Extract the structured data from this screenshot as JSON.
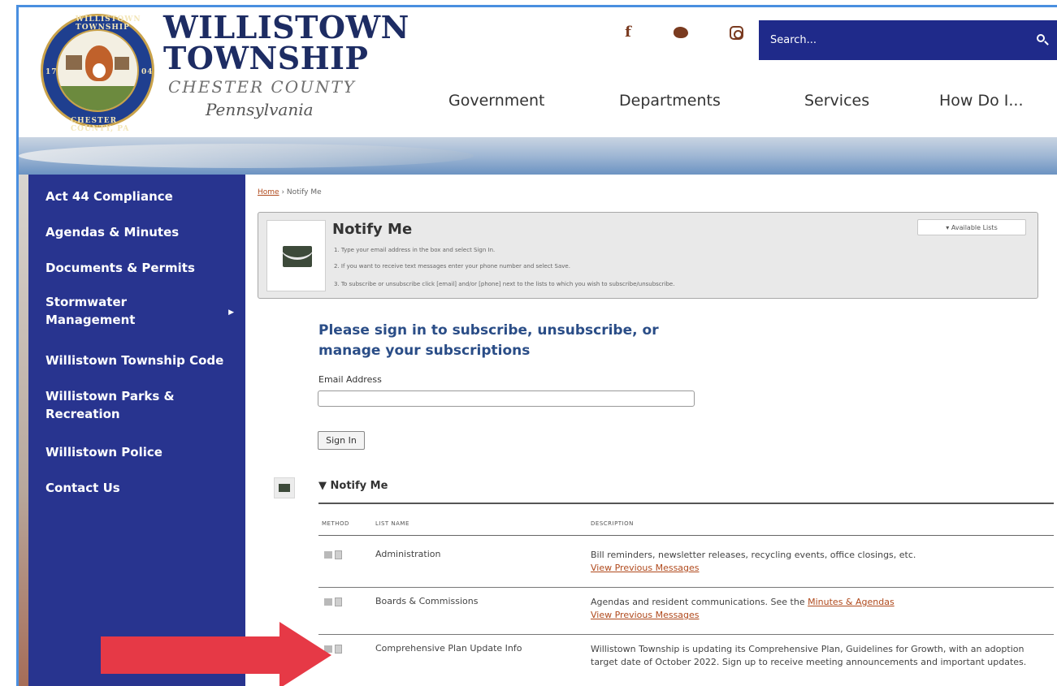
{
  "logo": {
    "title_line1": "WILLISTOWN",
    "title_line2": "TOWNSHIP",
    "county": "CHESTER COUNTY",
    "state": "Pennsylvania",
    "seal_top": "WILLISTOWN TOWNSHIP",
    "seal_bottom": "CHESTER COUNTY, PA",
    "seal_left": "17",
    "seal_right": "04"
  },
  "social": {
    "facebook": "f",
    "twitter_icon": "twitter-icon",
    "instagram_icon": "instagram-icon"
  },
  "search": {
    "placeholder": "Search..."
  },
  "nav": {
    "government": "Government",
    "departments": "Departments",
    "services": "Services",
    "how_do_i": "How Do I..."
  },
  "sidebar": {
    "items": [
      {
        "label": "Act 44 Compliance"
      },
      {
        "label": "Agendas & Minutes"
      },
      {
        "label": "Documents & Permits"
      },
      {
        "label": "Stormwater Management"
      },
      {
        "label": "Willistown Township Code"
      },
      {
        "label": "Willistown Parks & Recreation"
      },
      {
        "label": "Willistown Police"
      },
      {
        "label": "Contact Us"
      }
    ],
    "arrow": "▶"
  },
  "breadcrumb": {
    "home": "Home",
    "sep": " › ",
    "current": "Notify Me"
  },
  "notify_box": {
    "title": "Notify Me",
    "step1": "1. Type your email address in the box and select Sign In.",
    "step2": "2. If you want to receive text messages enter your phone number and select Save.",
    "step3": "3. To subscribe or unsubscribe click [email] and/or [phone] next to the lists to which you wish to subscribe/unsubscribe.",
    "available_lists": "▾  Available Lists"
  },
  "signin": {
    "heading": "Please sign in to subscribe, unsubscribe, or manage your subscriptions",
    "email_label": "Email Address",
    "email_value": "",
    "button": "Sign In"
  },
  "section": {
    "title": "▼ Notify Me"
  },
  "table": {
    "headers": {
      "method": "METHOD",
      "list_name": "LIST NAME",
      "description": "DESCRIPTION"
    },
    "rows": [
      {
        "name": "Administration",
        "description": "Bill reminders, newsletter releases, recycling events, office closings, etc.",
        "view": "View Previous Messages"
      },
      {
        "name": "Boards & Commissions",
        "description_before": "Agendas and resident communications. See the ",
        "description_link": "Minutes & Agendas",
        "view": "View Previous Messages"
      },
      {
        "name": "Comprehensive Plan Update Info",
        "description": "Willistown Township is updating its Comprehensive Plan, Guidelines for Growth, with an adoption target date of October 2022. Sign up to receive meeting announcements and important updates."
      }
    ]
  },
  "colors": {
    "navy": "#1f2a8a",
    "sidebar": "#28348f",
    "logo_text": "#1d2c63",
    "link": "#b04a1d",
    "heading": "#2a4d87",
    "annotation_arrow": "#e63946"
  }
}
